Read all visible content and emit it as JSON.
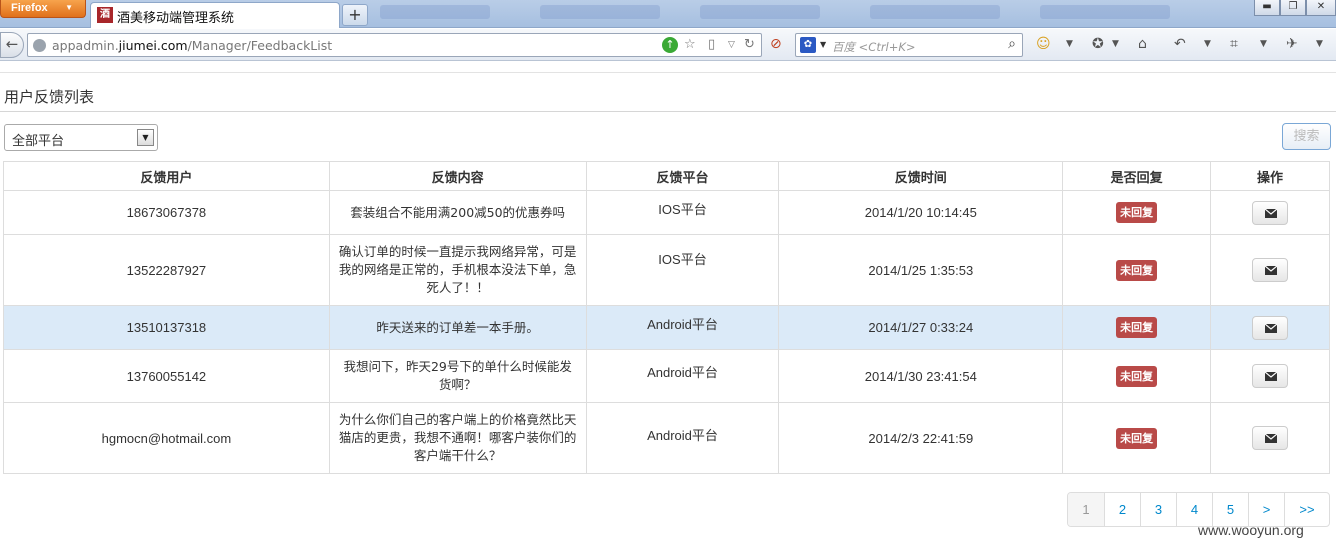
{
  "browser": {
    "menu_label": "Firefox",
    "tab_title": "酒美移动端管理系统",
    "favicon_text": "酒",
    "url_prefix": "appadmin.",
    "url_domain": "jiumei.com",
    "url_path": "/Manager/FeedbackList",
    "search_placeholder": "百度 <Ctrl+K>",
    "search_engine_icon": "paw-icon"
  },
  "page": {
    "title": "用户反馈列表",
    "platform_select": {
      "value": "全部平台"
    },
    "search_button": "搜索"
  },
  "table": {
    "headers": [
      "反馈用户",
      "反馈内容",
      "反馈平台",
      "反馈时间",
      "是否回复",
      "操作"
    ],
    "rows": [
      {
        "user": "18673067378",
        "content": "套装组合不能用满200减50的优惠券吗",
        "platform": "IOS平台",
        "time": "2014/1/20 10:14:45",
        "reply": "未回复"
      },
      {
        "user": "13522287927",
        "content": "确认订单的时候一直提示我网络异常，可是我的网络是正常的，手机根本没法下单，急死人了！！",
        "platform": "IOS平台",
        "time": "2014/1/25 1:35:53",
        "reply": "未回复"
      },
      {
        "user": "13510137318",
        "content": "昨天送来的订单差一本手册。",
        "platform": "Android平台",
        "time": "2014/1/27 0:33:24",
        "reply": "未回复"
      },
      {
        "user": "13760055142",
        "content": "我想问下，昨天29号下的单什么时候能发货啊？",
        "platform": "Android平台",
        "time": "2014/1/30 23:41:54",
        "reply": "未回复"
      },
      {
        "user": "hgmocn@hotmail.com",
        "content": "为什么你们自己的客户端上的价格竟然比天猫店的更贵，我想不通啊！哪客户装你们的客户端干什么？",
        "platform": "Android平台",
        "time": "2014/2/3 22:41:59",
        "reply": "未回复"
      }
    ],
    "action_icon": "envelope-icon"
  },
  "pagination": {
    "pages": [
      "1",
      "2",
      "3",
      "4",
      "5"
    ],
    "next": ">",
    "last": ">>",
    "active": "1"
  },
  "watermark": "www.wooyun.org",
  "colors": {
    "badge": "#b94a48",
    "row_highlight": "#dbeaf8",
    "link": "#0088cc"
  }
}
